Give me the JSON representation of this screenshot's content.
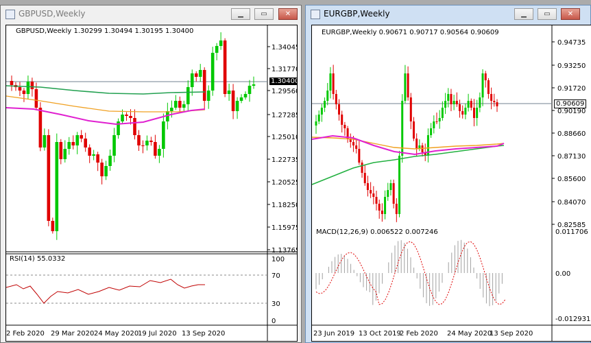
{
  "left_window": {
    "title": "GBPUSD,Weekly",
    "header_line": "GBPUSD,Weekly  1.30299 1.30494 1.30195 1.30400",
    "price_ticks": [
      "1.34045",
      "1.31770",
      "1.29560",
      "1.27285",
      "1.25010",
      "1.22735",
      "1.20525",
      "1.18250",
      "1.15975",
      "1.13765"
    ],
    "current_price": "1.30400",
    "rsi_label": "RSI(14) 55.0332",
    "rsi_ticks": [
      "100",
      "70",
      "30",
      "0"
    ],
    "date_ticks": [
      "2 Feb 2020",
      "29 Mar 2020",
      "24 May 2020",
      "19 Jul 2020",
      "13 Sep 2020"
    ],
    "colors": {
      "up": "#00c800",
      "down": "#e00000",
      "ma_green": "#22a050",
      "ma_orange": "#f0a020",
      "ma_magenta": "#e020d0",
      "rsi": "#c00000"
    }
  },
  "right_window": {
    "title": "EURGBP,Weekly",
    "header_line": "EURGBP,Weekly  0.90671 0.90717 0.90564 0.90609",
    "price_ticks": [
      "0.94735",
      "0.93250",
      "0.91720",
      "0.90190",
      "0.88660",
      "0.87130",
      "0.85600",
      "0.84070",
      "0.82585"
    ],
    "current_price": "0.90609",
    "macd_label": "MACD(12,26,9) 0.006522 0.007246",
    "macd_ticks": [
      "0.011706",
      "0.00",
      "-0.012931"
    ],
    "date_ticks": [
      "23 Jun 2019",
      "13 Oct 2019",
      "2 Feb 2020",
      "24 May 2020",
      "13 Sep 2020"
    ],
    "colors": {
      "up": "#00c800",
      "down": "#e00000",
      "ma_green": "#22b040",
      "ma_orange": "#f0a020",
      "ma_magenta": "#e020d0",
      "macd_signal": "#e00000"
    }
  },
  "window_buttons": {
    "minimize": "▁",
    "maximize": "▭",
    "close": "✕"
  }
}
